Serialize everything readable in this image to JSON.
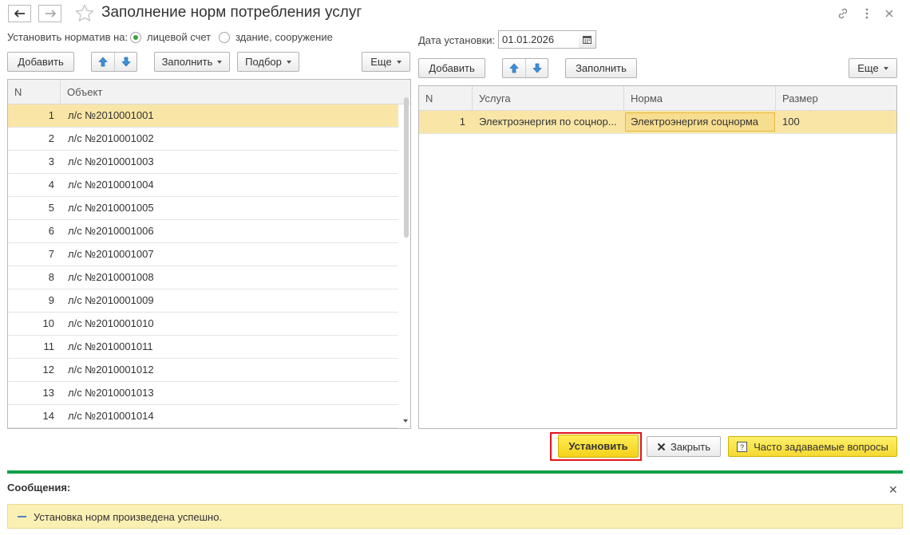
{
  "window": {
    "title": "Заполнение норм потребления услуг"
  },
  "norm_target": {
    "label": "Установить норматив на:",
    "options": [
      {
        "label": "лицевой счет",
        "checked": true
      },
      {
        "label": "здание, сооружение",
        "checked": false
      }
    ]
  },
  "date": {
    "label": "Дата установки:",
    "value": "01.01.2026"
  },
  "left_toolbar": {
    "add": "Добавить",
    "fill": "Заполнить",
    "select": "Подбор",
    "more": "Еще"
  },
  "right_toolbar": {
    "add": "Добавить",
    "fill": "Заполнить",
    "more": "Еще"
  },
  "objects_table": {
    "columns": [
      "N",
      "Объект"
    ],
    "rows": [
      {
        "n": "1",
        "object": "л/с №2010001001"
      },
      {
        "n": "2",
        "object": "л/с №2010001002"
      },
      {
        "n": "3",
        "object": "л/с №2010001003"
      },
      {
        "n": "4",
        "object": "л/с №2010001004"
      },
      {
        "n": "5",
        "object": "л/с №2010001005"
      },
      {
        "n": "6",
        "object": "л/с №2010001006"
      },
      {
        "n": "7",
        "object": "л/с №2010001007"
      },
      {
        "n": "8",
        "object": "л/с №2010001008"
      },
      {
        "n": "9",
        "object": "л/с №2010001009"
      },
      {
        "n": "10",
        "object": "л/с №2010001010"
      },
      {
        "n": "11",
        "object": "л/с №2010001011"
      },
      {
        "n": "12",
        "object": "л/с №2010001012"
      },
      {
        "n": "13",
        "object": "л/с №2010001013"
      },
      {
        "n": "14",
        "object": "л/с №2010001014"
      }
    ]
  },
  "services_table": {
    "columns": [
      "N",
      "Услуга",
      "Норма",
      "Размер"
    ],
    "rows": [
      {
        "n": "1",
        "service": "Электроэнергия по соцнор...",
        "norm": "Электроэнергия соцнорма",
        "size": "100"
      }
    ]
  },
  "actions": {
    "set": "Установить",
    "close": "Закрыть",
    "faq": "Часто задаваемые вопросы"
  },
  "messages": {
    "title": "Сообщения:",
    "items": [
      "Установка норм произведена успешно."
    ]
  },
  "colors": {
    "selected_row": "#f9e6a6",
    "accent_yellow": "#f5d21a",
    "green_separator": "#13a04a",
    "highlight_red": "#e2141d"
  }
}
